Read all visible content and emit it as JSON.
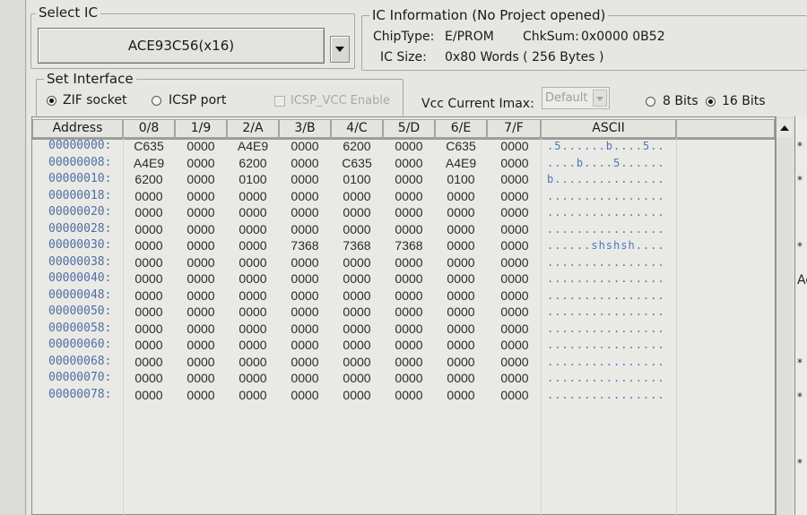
{
  "select_ic": {
    "legend": "Select IC",
    "selected_chip": "ACE93C56(x16)"
  },
  "ic_info": {
    "legend": "IC Information (No Project opened)",
    "chiptype_label": "ChipType:",
    "chiptype_value": "E/PROM",
    "chksum_label": "ChkSum:",
    "chksum_value": "0x0000 0B52",
    "icsize_label": "IC Size:",
    "icsize_value": "0x80 Words ( 256 Bytes )"
  },
  "interface": {
    "legend": "Set Interface",
    "zif_label": "ZIF socket",
    "icsp_label": "ICSP port",
    "icsp_vcc_label": "ICSP_VCC Enable",
    "vcc_label": "Vcc Current Imax:",
    "vcc_value": "Default",
    "bits8_label": "8 Bits",
    "bits16_label": "16 Bits",
    "zif_selected": true,
    "bits16_selected": true
  },
  "grid": {
    "headers": [
      "Address",
      "0/8",
      "1/9",
      "2/A",
      "3/B",
      "4/C",
      "5/D",
      "6/E",
      "7/F",
      "ASCII"
    ],
    "rows": [
      {
        "address": "00000000:",
        "values": [
          "C635",
          "0000",
          "A4E9",
          "0000",
          "6200",
          "0000",
          "C635",
          "0000"
        ],
        "ascii": ".5......b....5.."
      },
      {
        "address": "00000008:",
        "values": [
          "A4E9",
          "0000",
          "6200",
          "0000",
          "C635",
          "0000",
          "A4E9",
          "0000"
        ],
        "ascii": "....b....5......"
      },
      {
        "address": "00000010:",
        "values": [
          "6200",
          "0000",
          "0100",
          "0000",
          "0100",
          "0000",
          "0100",
          "0000"
        ],
        "ascii": "b..............."
      },
      {
        "address": "00000018:",
        "values": [
          "0000",
          "0000",
          "0000",
          "0000",
          "0000",
          "0000",
          "0000",
          "0000"
        ],
        "ascii": "................"
      },
      {
        "address": "00000020:",
        "values": [
          "0000",
          "0000",
          "0000",
          "0000",
          "0000",
          "0000",
          "0000",
          "0000"
        ],
        "ascii": "................"
      },
      {
        "address": "00000028:",
        "values": [
          "0000",
          "0000",
          "0000",
          "0000",
          "0000",
          "0000",
          "0000",
          "0000"
        ],
        "ascii": "................"
      },
      {
        "address": "00000030:",
        "values": [
          "0000",
          "0000",
          "0000",
          "7368",
          "7368",
          "7368",
          "0000",
          "0000"
        ],
        "ascii": "......shshsh...."
      },
      {
        "address": "00000038:",
        "values": [
          "0000",
          "0000",
          "0000",
          "0000",
          "0000",
          "0000",
          "0000",
          "0000"
        ],
        "ascii": "................"
      },
      {
        "address": "00000040:",
        "values": [
          "0000",
          "0000",
          "0000",
          "0000",
          "0000",
          "0000",
          "0000",
          "0000"
        ],
        "ascii": "................"
      },
      {
        "address": "00000048:",
        "values": [
          "0000",
          "0000",
          "0000",
          "0000",
          "0000",
          "0000",
          "0000",
          "0000"
        ],
        "ascii": "................"
      },
      {
        "address": "00000050:",
        "values": [
          "0000",
          "0000",
          "0000",
          "0000",
          "0000",
          "0000",
          "0000",
          "0000"
        ],
        "ascii": "................"
      },
      {
        "address": "00000058:",
        "values": [
          "0000",
          "0000",
          "0000",
          "0000",
          "0000",
          "0000",
          "0000",
          "0000"
        ],
        "ascii": "................"
      },
      {
        "address": "00000060:",
        "values": [
          "0000",
          "0000",
          "0000",
          "0000",
          "0000",
          "0000",
          "0000",
          "0000"
        ],
        "ascii": "................"
      },
      {
        "address": "00000068:",
        "values": [
          "0000",
          "0000",
          "0000",
          "0000",
          "0000",
          "0000",
          "0000",
          "0000"
        ],
        "ascii": "................"
      },
      {
        "address": "00000070:",
        "values": [
          "0000",
          "0000",
          "0000",
          "0000",
          "0000",
          "0000",
          "0000",
          "0000"
        ],
        "ascii": "................"
      },
      {
        "address": "00000078:",
        "values": [
          "0000",
          "0000",
          "0000",
          "0000",
          "0000",
          "0000",
          "0000",
          "0000"
        ],
        "ascii": "................"
      }
    ]
  },
  "right_panel": {
    "marks": [
      "*",
      "*",
      "*",
      "Ac",
      "*",
      "*",
      "*"
    ]
  },
  "colors": {
    "address_text": "#4f6fa3",
    "ascii_text": "#4d78b8",
    "window_bg": "#e6e6e3"
  }
}
